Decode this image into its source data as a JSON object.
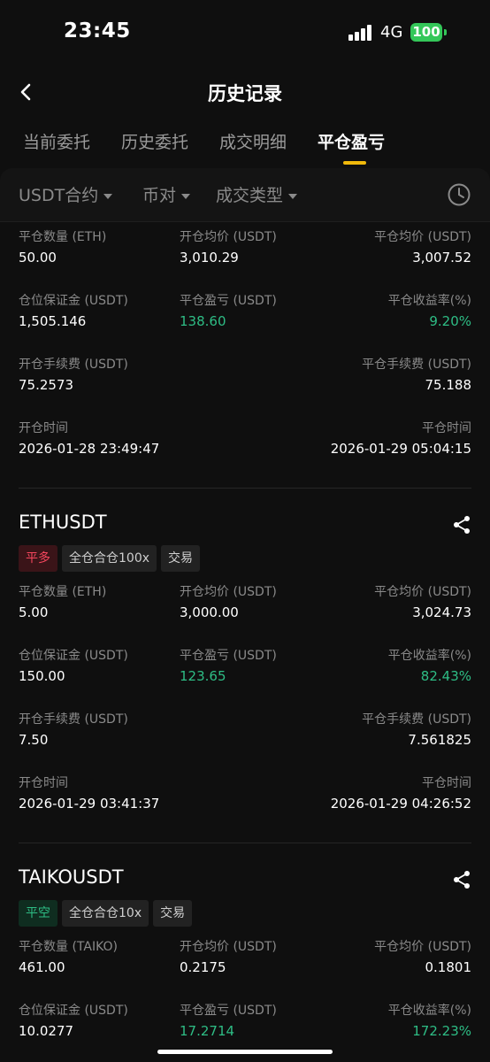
{
  "status": {
    "time": "23:45",
    "network": "4G",
    "battery": "100"
  },
  "header": {
    "title": "历史记录"
  },
  "tabs": [
    {
      "label": "当前委托"
    },
    {
      "label": "历史委托"
    },
    {
      "label": "成交明细"
    },
    {
      "label": "平仓盈亏",
      "active": true
    }
  ],
  "filters": [
    {
      "label": "USDT合约"
    },
    {
      "label": "币对"
    },
    {
      "label": "成交类型"
    }
  ],
  "records": [
    {
      "symbol": "",
      "tags": [],
      "fields": {
        "close_qty_label": "平仓数量 (ETH)",
        "close_qty": "50.00",
        "open_avg_label": "开仓均价 (USDT)",
        "open_avg": "3,010.29",
        "close_avg_label": "平仓均价 (USDT)",
        "close_avg": "3,007.52",
        "margin_label": "仓位保证金 (USDT)",
        "margin": "1,505.146",
        "pnl_label": "平仓盈亏 (USDT)",
        "pnl": "138.60",
        "roi_label": "平仓收益率(%)",
        "roi": "9.20%",
        "open_fee_label": "开仓手续费 (USDT)",
        "open_fee": "75.2573",
        "close_fee_label": "平仓手续费 (USDT)",
        "close_fee": "75.188",
        "open_time_label": "开仓时间",
        "open_time": "2026-01-28 23:49:47",
        "close_time_label": "平仓时间",
        "close_time": "2026-01-29 05:04:15"
      }
    },
    {
      "symbol": "ETHUSDT",
      "tags": [
        {
          "label": "平多",
          "style": "red"
        },
        {
          "label": "全仓合仓100x",
          "style": "gray"
        },
        {
          "label": "交易",
          "style": "gray"
        }
      ],
      "fields": {
        "close_qty_label": "平仓数量 (ETH)",
        "close_qty": "5.00",
        "open_avg_label": "开仓均价 (USDT)",
        "open_avg": "3,000.00",
        "close_avg_label": "平仓均价 (USDT)",
        "close_avg": "3,024.73",
        "margin_label": "仓位保证金 (USDT)",
        "margin": "150.00",
        "pnl_label": "平仓盈亏 (USDT)",
        "pnl": "123.65",
        "roi_label": "平仓收益率(%)",
        "roi": "82.43%",
        "open_fee_label": "开仓手续费 (USDT)",
        "open_fee": "7.50",
        "close_fee_label": "平仓手续费 (USDT)",
        "close_fee": "7.561825",
        "open_time_label": "开仓时间",
        "open_time": "2026-01-29 03:41:37",
        "close_time_label": "平仓时间",
        "close_time": "2026-01-29 04:26:52"
      }
    },
    {
      "symbol": "TAIKOUSDT",
      "tags": [
        {
          "label": "平空",
          "style": "green"
        },
        {
          "label": "全仓合仓10x",
          "style": "gray"
        },
        {
          "label": "交易",
          "style": "gray"
        }
      ],
      "fields": {
        "close_qty_label": "平仓数量 (TAIKO)",
        "close_qty": "461.00",
        "open_avg_label": "开仓均价 (USDT)",
        "open_avg": "0.2175",
        "close_avg_label": "平仓均价 (USDT)",
        "close_avg": "0.1801",
        "margin_label": "仓位保证金 (USDT)",
        "margin": "10.0277",
        "pnl_label": "平仓盈亏 (USDT)",
        "pnl": "17.2714",
        "roi_label": "平仓收益率(%)",
        "roi": "172.23%"
      }
    }
  ],
  "colors": {
    "profit": "#2ebd85",
    "loss": "#f6465d",
    "accent": "#f0b90b",
    "background": "#0f0f0f"
  }
}
